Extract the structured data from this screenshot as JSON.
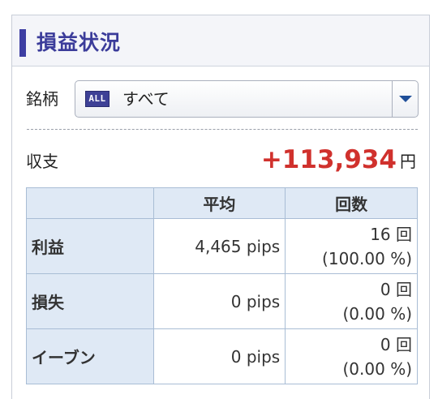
{
  "header": {
    "title": "損益状況"
  },
  "symbol": {
    "label": "銘柄",
    "icon_text": "ALL",
    "selected": "すべて",
    "icon": "chevron-down-icon"
  },
  "income": {
    "label": "収支",
    "value": "+113,934",
    "unit": "円",
    "color": "#d0312d"
  },
  "table": {
    "headers": [
      "",
      "平均",
      "回数"
    ],
    "rows": [
      {
        "label": "利益",
        "average": "4,465 pips",
        "count": "16 回",
        "percent": "(100.00 %)"
      },
      {
        "label": "損失",
        "average": "0 pips",
        "count": "0 回",
        "percent": "(0.00 %)"
      },
      {
        "label": "イーブン",
        "average": "0 pips",
        "count": "0 回",
        "percent": "(0.00 %)"
      }
    ]
  },
  "colors": {
    "accent": "#3d3ea3",
    "table_header_bg": "#dfe9f5",
    "table_border": "#a9bdd5"
  }
}
